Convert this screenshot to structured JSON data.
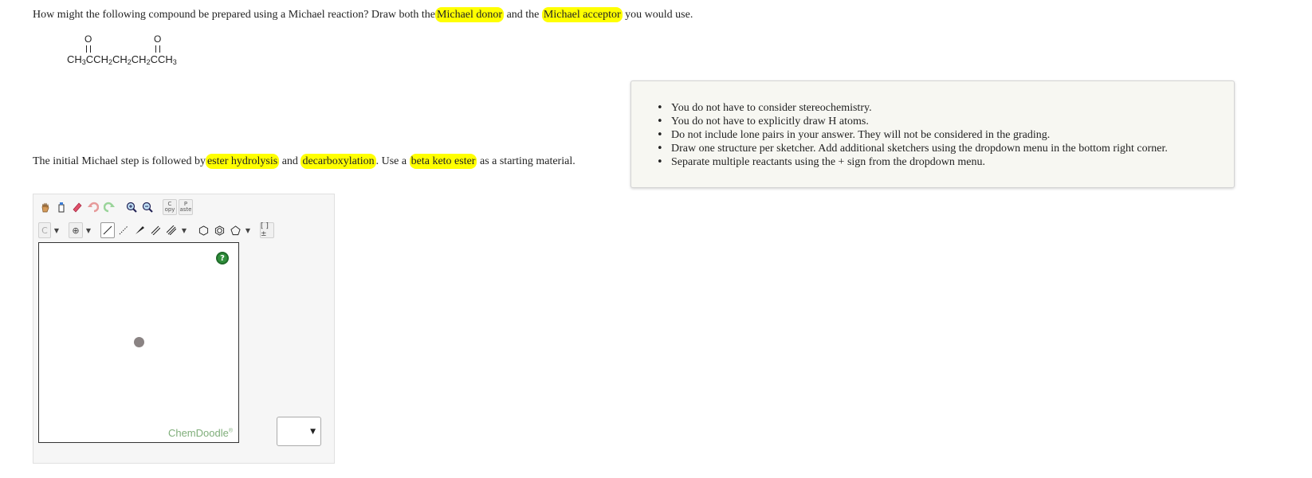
{
  "question": {
    "before": "How might the following compound be prepared using a Michael reaction? Draw both the",
    "hl1": "Michael donor",
    "mid": "and the",
    "hl2": "Michael acceptor",
    "after": "you would use."
  },
  "compound": {
    "o_left": "O",
    "o_right": "O",
    "parts": [
      "CH",
      "3",
      "CCH",
      "2",
      "CH",
      "2",
      "CH",
      "2",
      "CCH",
      "3"
    ]
  },
  "initial_step": {
    "t1": "The initial Michael step is followed by",
    "h1": "ester hydrolysis",
    "t2": "and",
    "h2": "decarboxylation",
    "t3": ". Use a",
    "h3": "beta keto ester",
    "t4": "as a starting material."
  },
  "notes": [
    "You do not have to consider stereochemistry.",
    "You do not have to explicitly draw H atoms.",
    "Do not include lone pairs in your answer. They will not be considered in the grading.",
    "Draw one structure per sketcher. Add additional sketchers using the dropdown menu in the bottom right corner.",
    "Separate multiple reactants using the + sign from the dropdown menu."
  ],
  "sketcher": {
    "toolbar1": [
      "hand-icon",
      "clear-icon",
      "eraser-icon",
      "undo-icon",
      "redo-icon",
      "zoom-in-icon",
      "zoom-out-icon"
    ],
    "copy_label": "C",
    "copy_sub": "opy",
    "paste_label": "P",
    "paste_sub": "aste",
    "element_label": "C",
    "charge_label": "⊕",
    "bracket_label": "[ ]±",
    "help_label": "?",
    "brand": "ChemDoodle",
    "brand_mark": "®",
    "dropdown_arrow": "▼",
    "colors": {
      "help": "#2f8f3b",
      "brand": "#7fae7a",
      "highlight": "#ffff00"
    }
  },
  "add_select": {
    "value": "",
    "arrow": "▼"
  }
}
